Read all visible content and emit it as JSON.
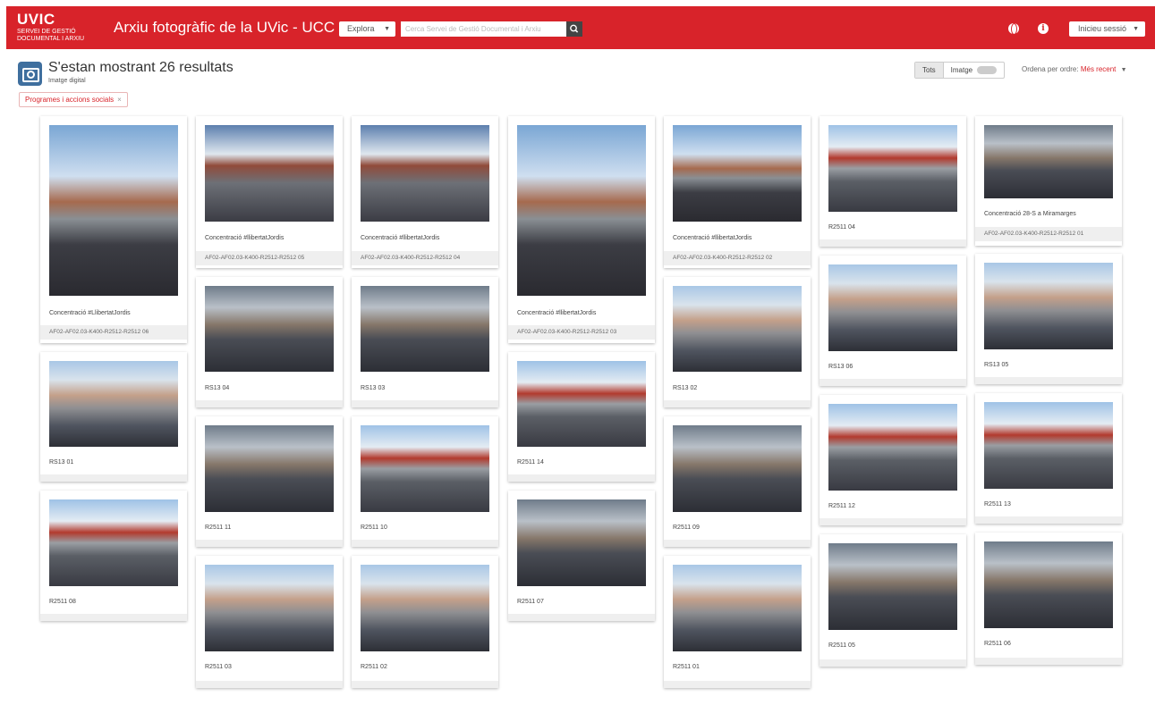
{
  "header": {
    "logo_brand": "UVIC",
    "logo_sub1": "SERVEI DE GESTIÓ",
    "logo_sub2": "DOCUMENTAL I ARXIU",
    "site_title": "Arxiu fotogràfic de la UVic - UCC",
    "explore_label": "Explora",
    "search_placeholder": "Cerca Servei de Gestió Documental i Arxiu",
    "login_label": "Inicieu sessió"
  },
  "results": {
    "title": "S'estan mostrant 26 resultats",
    "subtitle": "Imatge digital",
    "filter_tag": "Programes i accions socials",
    "view_all": "Tots",
    "view_image": "Imatge",
    "sort_label": "Ordena per ordre:",
    "sort_value": "Més recent"
  },
  "cards": [
    {
      "title": "Concentració #LlibertatJordis",
      "ref": "AF02-AF02.03-K400-R2512-R2512 06"
    },
    {
      "title": "RS13 01",
      "ref": ""
    },
    {
      "title": "R2511 08",
      "ref": ""
    },
    {
      "title": "Concentració #llibertatJordis",
      "ref": "AF02-AF02.03-K400-R2512-R2512 05"
    },
    {
      "title": "RS13 04",
      "ref": ""
    },
    {
      "title": "R2511 11",
      "ref": ""
    },
    {
      "title": "R2511 03",
      "ref": ""
    },
    {
      "title": "Concentració #llibertatJordis",
      "ref": "AF02-AF02.03-K400-R2512-R2512 04"
    },
    {
      "title": "RS13 03",
      "ref": ""
    },
    {
      "title": "R2511 10",
      "ref": ""
    },
    {
      "title": "R2511 02",
      "ref": ""
    },
    {
      "title": "Concentració #llibertatJordis",
      "ref": "AF02-AF02.03-K400-R2512-R2512 03"
    },
    {
      "title": "R2511 14",
      "ref": ""
    },
    {
      "title": "R2511 07",
      "ref": ""
    },
    {
      "title": "Concentració #llibertatJordis",
      "ref": "AF02-AF02.03-K400-R2512-R2512 02"
    },
    {
      "title": "RS13 02",
      "ref": ""
    },
    {
      "title": "R2511 09",
      "ref": ""
    },
    {
      "title": "R2511 01",
      "ref": ""
    },
    {
      "title": "R2511 04",
      "ref": ""
    },
    {
      "title": "RS13 06",
      "ref": ""
    },
    {
      "title": "R2511 12",
      "ref": ""
    },
    {
      "title": "R2511 05",
      "ref": ""
    },
    {
      "title": "Concentració 28-S a Miramarges",
      "ref": "AF02-AF02.03-K400-R2512-R2512 01"
    },
    {
      "title": "RS13 05",
      "ref": ""
    },
    {
      "title": "R2511 13",
      "ref": ""
    },
    {
      "title": "R2511 06",
      "ref": ""
    }
  ]
}
